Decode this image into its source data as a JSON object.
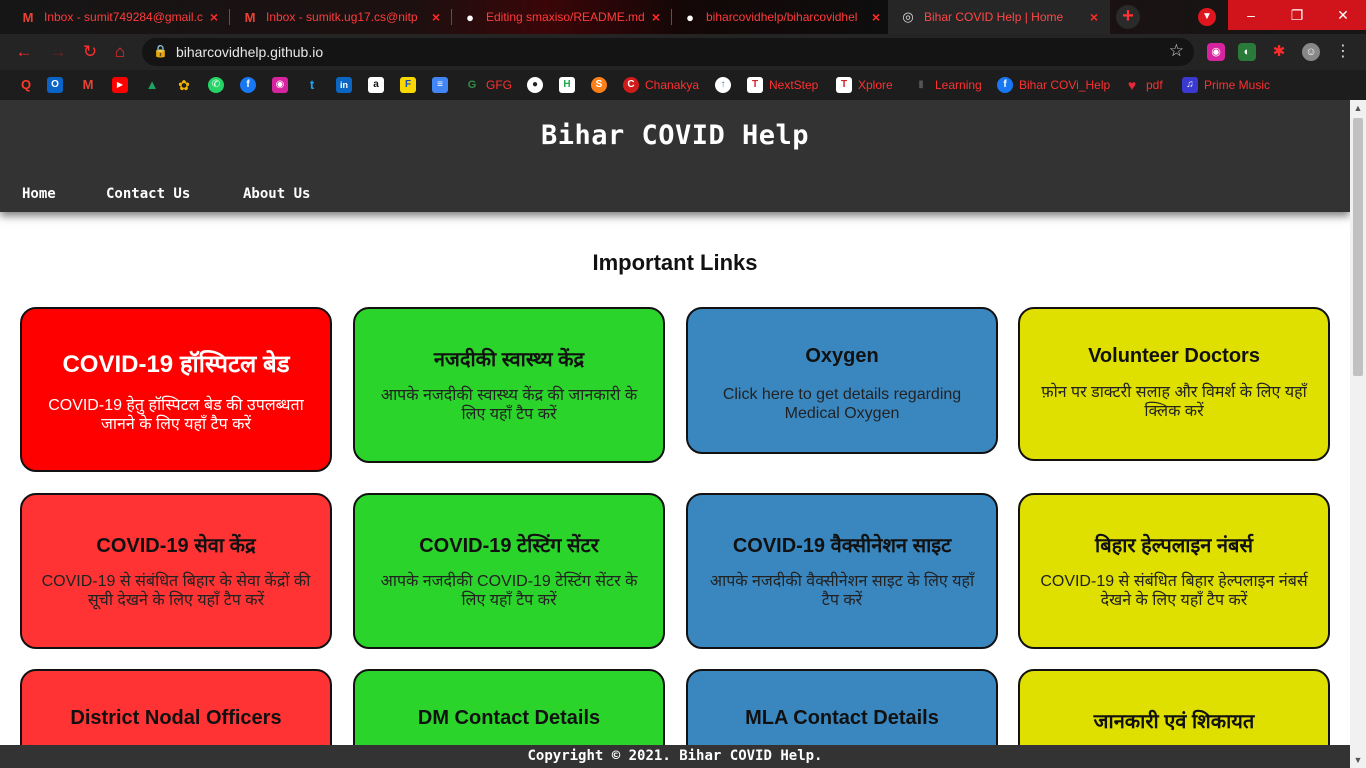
{
  "browser": {
    "tabs": [
      {
        "title": "Inbox - sumit749284@gmail.c",
        "icon": "gmail-icon",
        "fav": "M",
        "fav_color": "#ea4335"
      },
      {
        "title": "Inbox - sumitk.ug17.cs@nitp",
        "icon": "gmail-icon",
        "fav": "M",
        "fav_color": "#ea4335"
      },
      {
        "title": "Editing smaxiso/README.md",
        "icon": "github-icon",
        "fav": "●",
        "fav_color": "#ffffff"
      },
      {
        "title": "biharcovidhelp/biharcovidhel",
        "icon": "github-icon",
        "fav": "●",
        "fav_color": "#ffffff"
      },
      {
        "title": "Bihar COVID Help | Home",
        "icon": "globe-icon",
        "fav": "◎",
        "fav_color": "#dddddd"
      }
    ],
    "new_tab": "+",
    "url": "biharcovidhelp.github.io",
    "bookmarks": [
      {
        "label": "",
        "icon": "search-icon",
        "glyph": "Q",
        "color": "#ff3a2a"
      },
      {
        "label": "",
        "icon": "outlook-icon",
        "glyph": "O",
        "color": "#0a64c8"
      },
      {
        "label": "",
        "icon": "gmail-icon",
        "glyph": "M",
        "color": "#ea4335"
      },
      {
        "label": "",
        "icon": "youtube-icon",
        "glyph": "▶",
        "color": "#ff0000"
      },
      {
        "label": "",
        "icon": "drive-icon",
        "glyph": "▲",
        "color": "#1ea362"
      },
      {
        "label": "",
        "icon": "photos-icon",
        "glyph": "✿",
        "color": "#f4b400"
      },
      {
        "label": "",
        "icon": "whatsapp-icon",
        "glyph": "✆",
        "color": "#25d366"
      },
      {
        "label": "",
        "icon": "facebook-icon",
        "glyph": "f",
        "color": "#1877f2"
      },
      {
        "label": "",
        "icon": "instagram-icon",
        "glyph": "◉",
        "color": "#d6249f"
      },
      {
        "label": "",
        "icon": "twitter-icon",
        "glyph": "t",
        "color": "#1da1f2"
      },
      {
        "label": "",
        "icon": "linkedin-icon",
        "glyph": "in",
        "color": "#0a66c2"
      },
      {
        "label": "",
        "icon": "amazon-icon",
        "glyph": "a",
        "color": "#ffffff"
      },
      {
        "label": "",
        "icon": "flipkart-icon",
        "glyph": "F",
        "color": "#f8d800"
      },
      {
        "label": "",
        "icon": "docs-icon",
        "glyph": "≡",
        "color": "#4285f4"
      },
      {
        "label": "GFG",
        "icon": "gfg-icon",
        "glyph": "G",
        "color": "#2f8d46"
      },
      {
        "label": "",
        "icon": "github-icon",
        "glyph": "●",
        "color": "#333333"
      },
      {
        "label": "",
        "icon": "hackerrank-icon",
        "glyph": "H",
        "color": "#1ba94c"
      },
      {
        "label": "",
        "icon": "swiggy-icon",
        "glyph": "S",
        "color": "#fc8019"
      },
      {
        "label": "Chanakya",
        "icon": "chanakya-icon",
        "glyph": "C",
        "color": "#d11b1b"
      },
      {
        "label": "",
        "icon": "upload-icon",
        "glyph": "↑",
        "color": "#3a7bd5"
      },
      {
        "label": "NextStep",
        "icon": "tcs-icon",
        "glyph": "T",
        "color": "#d3212c"
      },
      {
        "label": "Xplore",
        "icon": "tcs-icon",
        "glyph": "T",
        "color": "#d3212c"
      },
      {
        "label": "Learning",
        "icon": "folder-icon",
        "glyph": "▮",
        "color": "#333333"
      },
      {
        "label": "Bihar COVi_Help",
        "icon": "facebook-icon",
        "glyph": "f",
        "color": "#1877f2"
      },
      {
        "label": "pdf",
        "icon": "heart-icon",
        "glyph": "♥",
        "color": "#e8283a"
      },
      {
        "label": "Prime Music",
        "icon": "music-icon",
        "glyph": "♫",
        "color": "#3a3ad0"
      }
    ]
  },
  "site": {
    "title": "Bihar COVID Help",
    "nav": [
      "Home",
      "Contact Us",
      "About Us"
    ],
    "section_title": "Important Links",
    "cards": [
      {
        "title": "COVID-19 हॉस्पिटल बेड",
        "desc": "COVID-19 हेतु हॉस्पिटल बेड की उपलब्धता जानने के लिए यहाँ टैप करें",
        "color": "red"
      },
      {
        "title": "नजदीकी स्वास्थ्य केंद्र",
        "desc": "आपके नजदीकी स्वास्थ्य केंद्र की जानकारी के लिए यहाँ टैप करें",
        "color": "green"
      },
      {
        "title": "Oxygen",
        "desc": "Click here to get details regarding Medical Oxygen",
        "color": "blue"
      },
      {
        "title": "Volunteer Doctors",
        "desc": "फ़ोन पर डाक्टरी सलाह और विमर्श के लिए यहाँ क्लिक करें",
        "color": "yellow"
      },
      {
        "title": "COVID-19 सेवा केंद्र",
        "desc": "COVID-19 से संबंधित बिहार के सेवा केंद्रों की सूची देखने के लिए यहाँ टैप करें",
        "color": "salmon"
      },
      {
        "title": "COVID-19 टेस्टिंग सेंटर",
        "desc": "आपके नजदीकी COVID-19 टेस्टिंग सेंटर के लिए यहाँ टैप करें",
        "color": "green"
      },
      {
        "title": "COVID-19 वैक्सीनेशन साइट",
        "desc": "आपके नजदीकी वैक्सीनेशन साइट के लिए यहाँ टैप करें",
        "color": "blue"
      },
      {
        "title": "बिहार हेल्पलाइन नंबर्स",
        "desc": "COVID-19 से संबंधित बिहार हेल्पलाइन नंबर्स देखने के लिए यहाँ टैप करें",
        "color": "yellow"
      },
      {
        "title": "District Nodal Officers",
        "desc": "",
        "color": "salmon"
      },
      {
        "title": "DM Contact Details",
        "desc": "",
        "color": "green"
      },
      {
        "title": "MLA Contact Details",
        "desc": "",
        "color": "blue"
      },
      {
        "title": "जानकारी एवं शिकायत",
        "desc": "",
        "color": "yellow"
      }
    ],
    "footer": "Copyright © 2021. Bihar COVID Help."
  }
}
